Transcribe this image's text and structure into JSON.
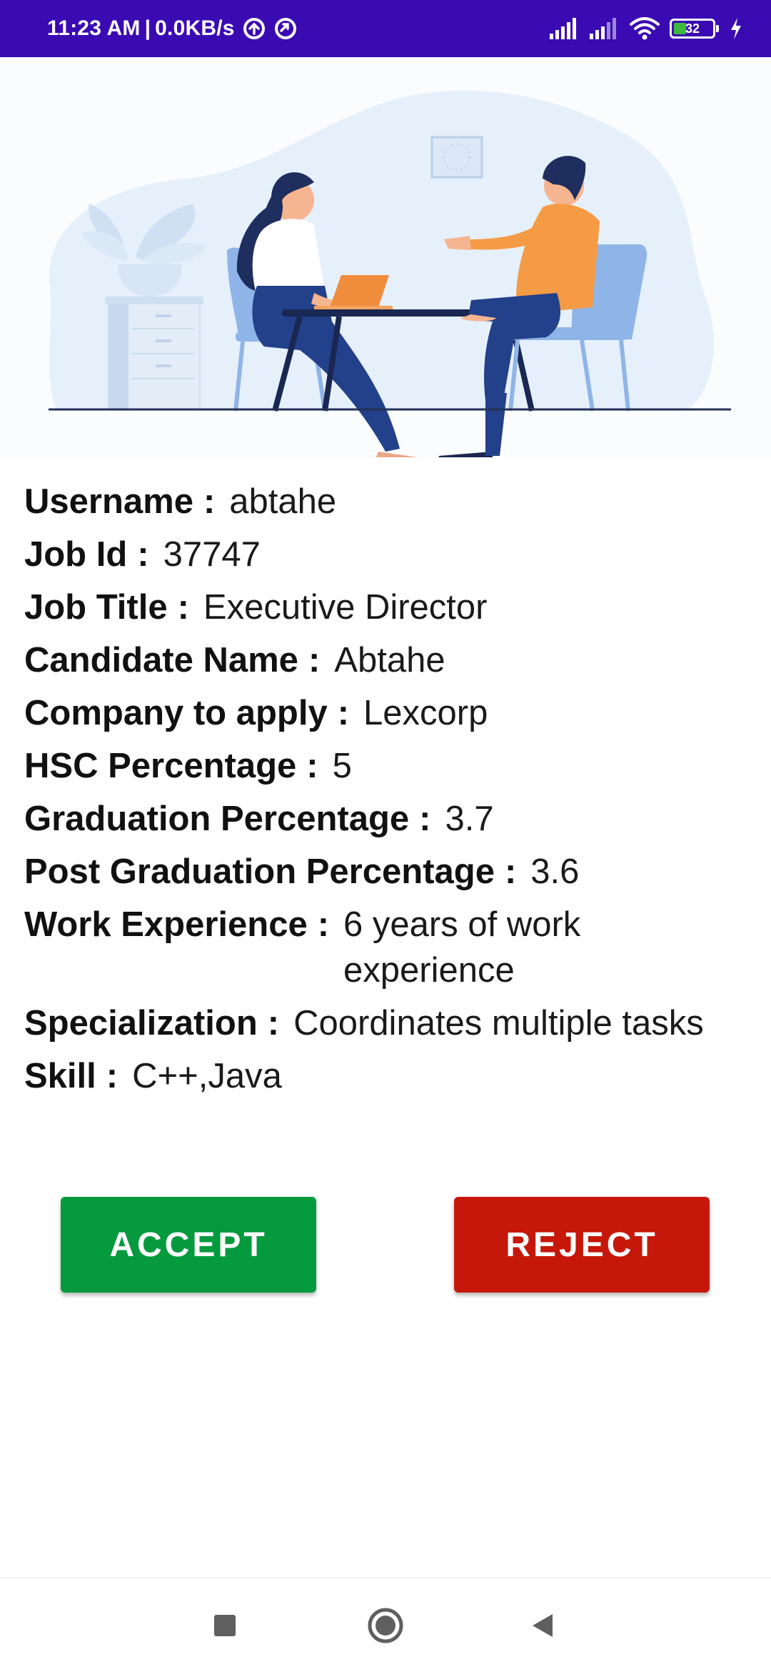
{
  "status_bar": {
    "time": "11:23 AM",
    "separator": "|",
    "speed": "0.0KB/s",
    "battery_level": "32",
    "battery_fraction": 0.32,
    "background_color": "#3a0ab3",
    "icons": [
      "sync-icon",
      "sync-icon",
      "signal-icon",
      "signal-icon",
      "wifi-icon",
      "battery-icon",
      "charging-icon"
    ]
  },
  "illustration": {
    "icon": "job-interview-illustration"
  },
  "details": {
    "username": {
      "label": "Username",
      "colon": ":",
      "value": "abtahe"
    },
    "job_id": {
      "label": "Job Id",
      "colon": ":",
      "value": "37747"
    },
    "job_title": {
      "label": "Job Title",
      "colon": ":",
      "value": "Executive Director"
    },
    "candidate_name": {
      "label": "Candidate Name",
      "colon": ":",
      "value": "Abtahe"
    },
    "company": {
      "label": "Company to apply",
      "colon": ":",
      "value": "Lexcorp"
    },
    "hsc": {
      "label": "HSC Percentage",
      "colon": ":",
      "value": "5"
    },
    "graduation": {
      "label": "Graduation Percentage",
      "colon": ":",
      "value": "3.7"
    },
    "post_graduation": {
      "label": "Post Graduation Percentage",
      "colon": ":",
      "value": "3.6"
    },
    "work_experience": {
      "label": "Work Experience",
      "colon": ":",
      "value": "6 years of work experience"
    },
    "specialization": {
      "label": "Specialization",
      "colon": ":",
      "value": "Coordinates multiple tasks"
    },
    "skill": {
      "label": "Skill",
      "colon": ":",
      "value": "C++,Java"
    }
  },
  "actions": {
    "accept_label": "ACCEPT",
    "reject_label": "REJECT",
    "accept_color": "#059a3e",
    "reject_color": "#c5180a"
  },
  "nav_bar": {
    "icons": [
      "recents-square-icon",
      "home-circle-icon",
      "back-triangle-icon"
    ]
  }
}
